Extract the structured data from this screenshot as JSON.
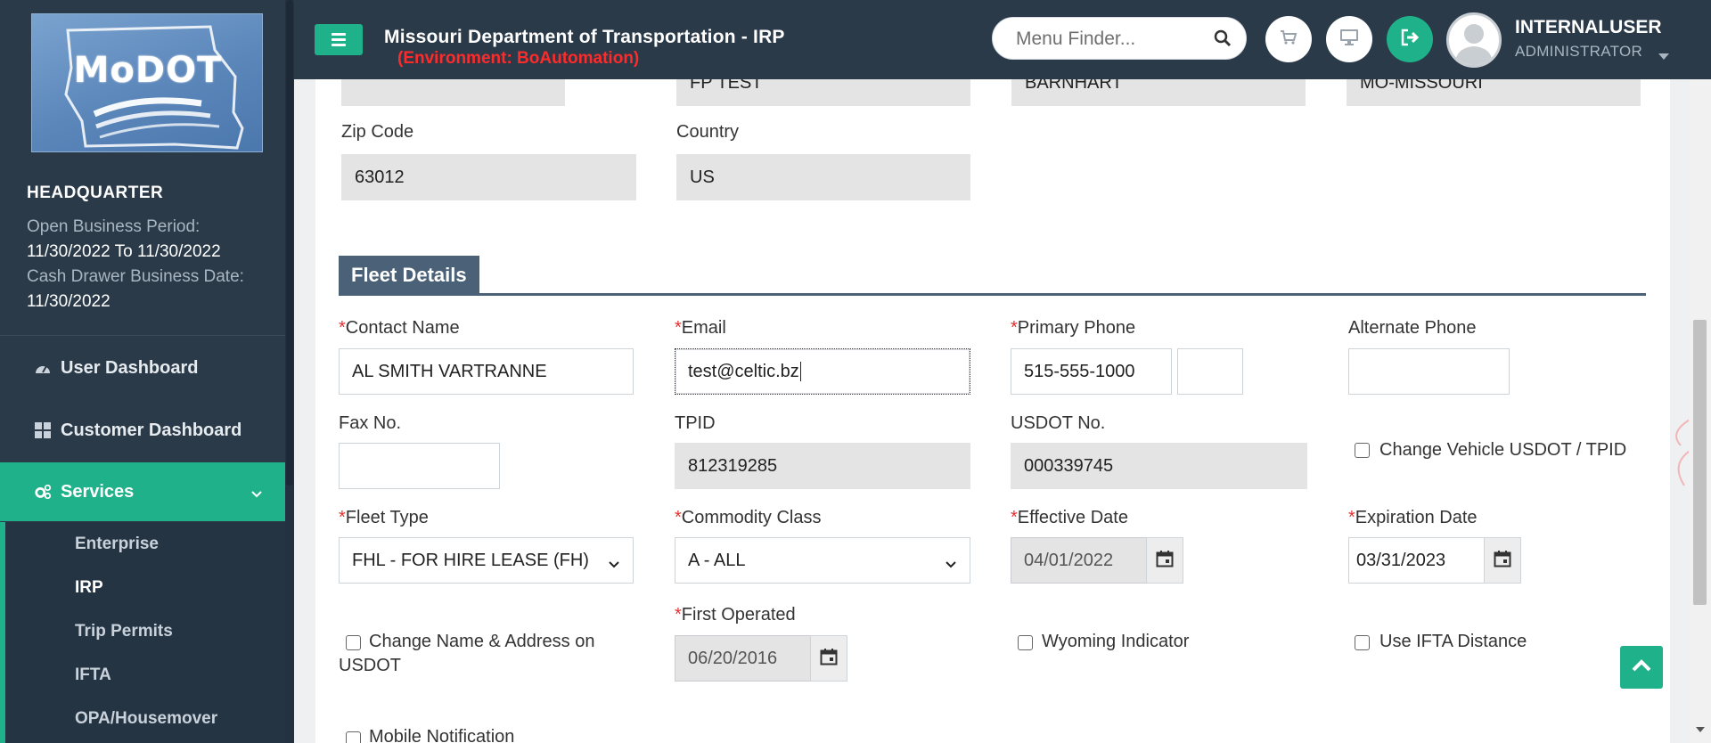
{
  "colors": {
    "sidebar_bg": "#2b3a49",
    "accent_green": "#1fb18a",
    "env_red": "#ff2a2a",
    "section_header_bg": "#4b6177",
    "required_star": "#e23030"
  },
  "header": {
    "menu_toggle_icon": "hamburger-icon",
    "title": "Missouri Department of Transportation - IRP",
    "environment": "(Environment: BoAutomation)",
    "menu_finder": {
      "placeholder": "Menu Finder...",
      "icon": "search-icon"
    },
    "buttons": [
      {
        "name": "cart",
        "icon": "shopping-cart-icon"
      },
      {
        "name": "monitor",
        "icon": "desktop-icon"
      },
      {
        "name": "logout",
        "icon": "sign-out-icon"
      }
    ],
    "user": {
      "name": "INTERNALUSER",
      "role": "ADMINISTRATOR"
    }
  },
  "sidebar": {
    "logo_text": "MoDOT",
    "office": "HEADQUARTER",
    "open_business_period_label": "Open Business Period:",
    "open_business_period_value": "11/30/2022 To 11/30/2022",
    "cash_drawer_label": "Cash Drawer Business Date:",
    "cash_drawer_value": "11/30/2022",
    "nav": [
      {
        "label": "User Dashboard",
        "icon": "dashboard-gauge-icon"
      },
      {
        "label": "Customer Dashboard",
        "icon": "grid-icon"
      },
      {
        "label": "Services",
        "icon": "cogs-icon",
        "expanded": true
      }
    ],
    "submenu": [
      "Enterprise",
      "IRP",
      "Trip Permits",
      "IFTA",
      "OPA/Housemover"
    ],
    "current_submenu": "IRP"
  },
  "address_partial": {
    "field1_value": "",
    "city_value": "FP TEST",
    "county_value": "BARNHART",
    "state_value": "MO-MISSOURI"
  },
  "address": {
    "zip_label": "Zip Code",
    "zip_value": "63012",
    "country_label": "Country",
    "country_value": "US"
  },
  "fleet": {
    "section_title": "Fleet Details",
    "contact_name_label": "Contact Name",
    "contact_name_value": "AL SMITH VARTRANNE",
    "email_label": "Email",
    "email_value": "test@celtic.bz",
    "primary_phone_label": "Primary Phone",
    "primary_phone_value": "515-555-1000",
    "primary_phone_ext": "",
    "alternate_phone_label": "Alternate Phone",
    "alternate_phone_value": "",
    "fax_label": "Fax No.",
    "fax_value": "",
    "tpid_label": "TPID",
    "tpid_value": "812319285",
    "usdot_label": "USDOT No.",
    "usdot_value": "000339745",
    "change_usdot_label": "Change Vehicle USDOT / TPID",
    "change_usdot_checked": false,
    "fleet_type_label": "Fleet Type",
    "fleet_type_value": "FHL - FOR HIRE LEASE (FH)",
    "commodity_label": "Commodity Class",
    "commodity_value": "A - ALL",
    "effective_date_label": "Effective Date",
    "effective_date_value": "04/01/2022",
    "expiration_date_label": "Expiration Date",
    "expiration_date_value": "03/31/2023",
    "change_name_label_1": "Change Name & Address on",
    "change_name_label_2": "USDOT",
    "change_name_checked": false,
    "first_operated_label": "First Operated",
    "first_operated_value": "06/20/2016",
    "wyoming_label": "Wyoming Indicator",
    "wyoming_checked": false,
    "ifta_label": "Use IFTA Distance",
    "ifta_checked": false,
    "mobile_notification_label": "Mobile Notification",
    "required_marker": "*"
  }
}
